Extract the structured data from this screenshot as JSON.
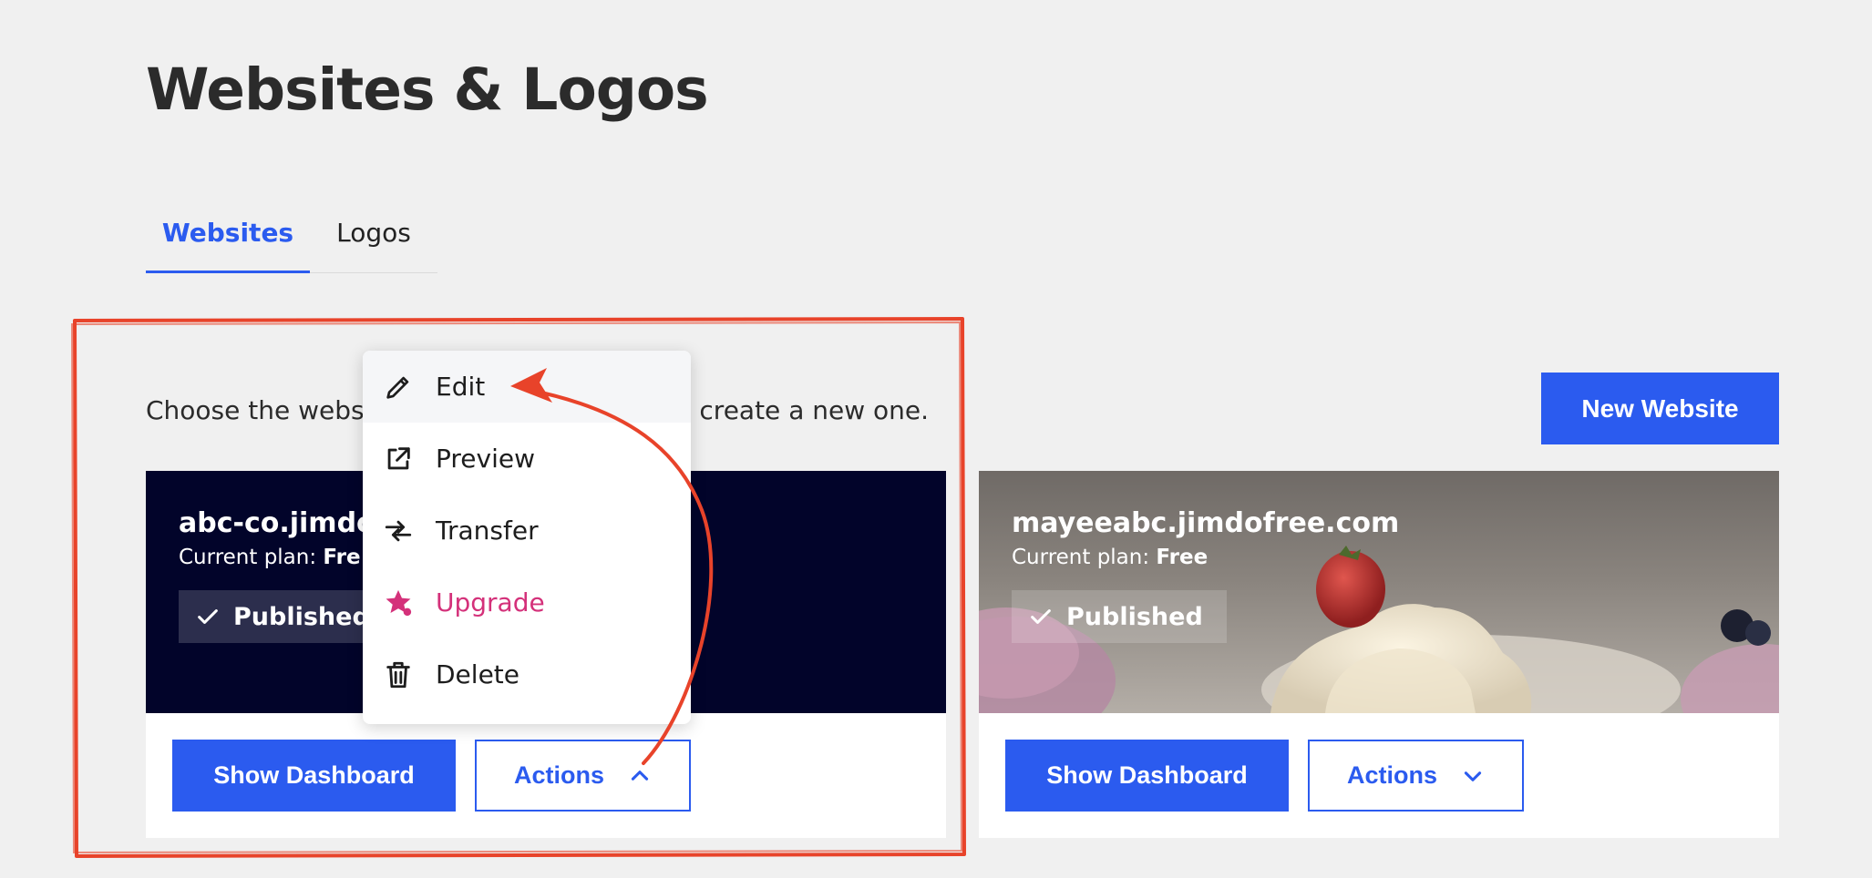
{
  "header": {
    "title": "Websites & Logos"
  },
  "tabs": [
    {
      "label": "Websites",
      "active": true
    },
    {
      "label": "Logos",
      "active": false
    }
  ],
  "intro": {
    "before": "Choose the websi",
    "after": "create a new one."
  },
  "new_website_label": "New Website",
  "sites": [
    {
      "name": "abc-co.jimdo",
      "plan_label": "Current plan:",
      "plan_value": "Fre",
      "status": "Published",
      "dashboard_label": "Show Dashboard",
      "actions_label": "Actions",
      "actions_open": true
    },
    {
      "name": "mayeeabc.jimdofree.com",
      "plan_label": "Current plan:",
      "plan_value": "Free",
      "status": "Published",
      "dashboard_label": "Show Dashboard",
      "actions_label": "Actions",
      "actions_open": false
    }
  ],
  "actions_menu": {
    "items": [
      {
        "label": "Edit",
        "icon": "pencil-icon"
      },
      {
        "label": "Preview",
        "icon": "external-link-icon"
      },
      {
        "label": "Transfer",
        "icon": "transfer-arrows-icon"
      },
      {
        "label": "Upgrade",
        "icon": "star-icon"
      },
      {
        "label": "Delete",
        "icon": "trash-icon"
      }
    ]
  },
  "colors": {
    "accent": "#2b5bef",
    "upgrade": "#d4317a",
    "annotation": "#e8432a",
    "card1_hero": "#02042a",
    "page_bg": "#f0f0f0"
  }
}
